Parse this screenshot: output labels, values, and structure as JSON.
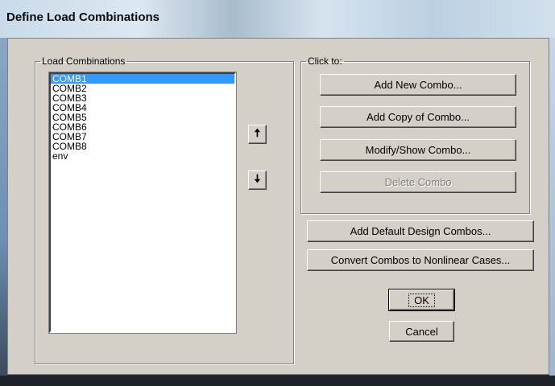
{
  "window": {
    "title": "Define Load Combinations"
  },
  "load_combinations": {
    "label": "Load Combinations",
    "items": [
      "COMB1",
      "COMB2",
      "COMB3",
      "COMB4",
      "COMB5",
      "COMB6",
      "COMB7",
      "COMB8",
      "env"
    ],
    "selected": "COMB1"
  },
  "reorder": {
    "up_icon": "up-arrow-icon",
    "down_icon": "down-arrow-icon",
    "up_glyph": "🠅",
    "down_glyph": "🠇"
  },
  "click_to": {
    "label": "Click to:",
    "add_new": "Add New Combo...",
    "add_copy": "Add Copy of Combo...",
    "modify_show": "Modify/Show Combo...",
    "delete": "Delete Combo"
  },
  "actions": {
    "add_default": "Add Default Design Combos...",
    "convert": "Convert Combos to Nonlinear Cases...",
    "ok": "OK",
    "cancel": "Cancel"
  },
  "colors": {
    "selection": "#3399ff",
    "dialog_face": "#d4d0c8"
  }
}
